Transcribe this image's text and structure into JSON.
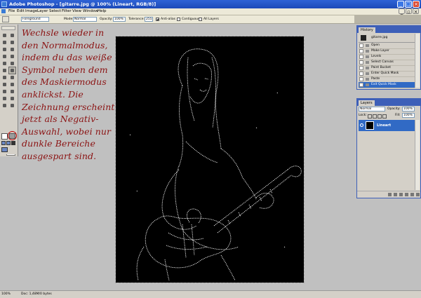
{
  "window": {
    "title": "Adobe Photoshop - [gitarre.jpg @ 100% (Lineart, RGB/8)]"
  },
  "menu": [
    "File",
    "Edit",
    "Image",
    "Layer",
    "Select",
    "Filter",
    "View",
    "Window",
    "Help"
  ],
  "options": {
    "fill_source": "Foreground",
    "mode_label": "Mode:",
    "mode_value": "Normal",
    "opacity_label": "Opacity:",
    "opacity_value": "100%",
    "tolerance_label": "Tolerance:",
    "tolerance_value": "255",
    "antialias_label": "Anti-alias",
    "contiguous_label": "Contiguous",
    "all_layers_label": "All Layers"
  },
  "instruction": "Wechsle wieder in den Normalmodus, indem du das weiße Symbol neben dem des Maskiermodus anklickst. Die Zeichnung erscheint jetzt als Negativ-Auswahl, wobei nur dunkle Bereiche ausgespart sind.",
  "history": {
    "tab": "History",
    "snapshot": "gitarre.jpg",
    "items": [
      "Open",
      "Make Layer",
      "Levels",
      "Select Canvas",
      "Paint Bucket",
      "Enter Quick Mask",
      "Paste",
      "Exit Quick Mask"
    ],
    "selected_index": 7
  },
  "layers": {
    "tab": "Layers",
    "blend_mode": "Normal",
    "opacity_label": "Opacity:",
    "opacity_value": "100%",
    "lock_label": "Lock:",
    "fill_label": "Fill:",
    "fill_value": "100%",
    "layer_name": "Lineart"
  },
  "status": {
    "zoom": "100%",
    "doc": "Doc: 1,48M/0 bytes"
  }
}
